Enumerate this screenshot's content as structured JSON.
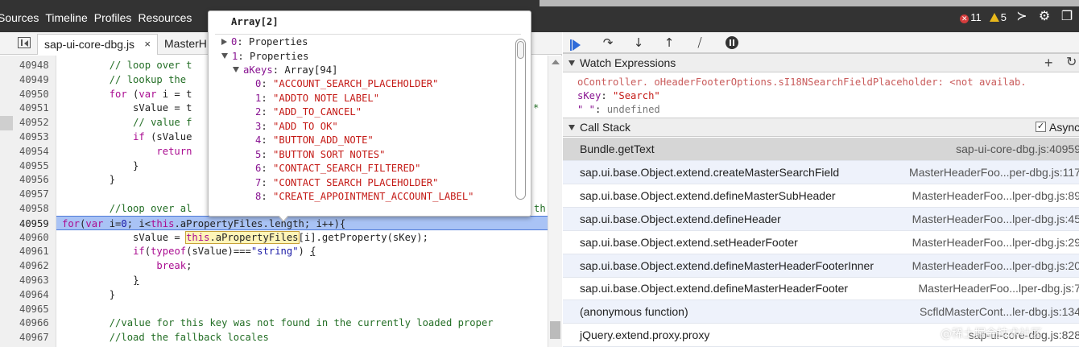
{
  "topbar": {
    "tabs": [
      "Sources",
      "Timeline",
      "Profiles",
      "Resources"
    ],
    "error_count": "11",
    "warning_count": "5"
  },
  "editor": {
    "active_file": "sap-ui-core-dbg.js",
    "second_file": "MasterH",
    "close_glyph": "×",
    "lines": [
      {
        "n": "40948",
        "html": "        <span class=\"cm\">// loop over t</span>"
      },
      {
        "n": "40949",
        "html": "        <span class=\"cm\">// lookup the</span>"
      },
      {
        "n": "40950",
        "html": "        <span class=\"kw\">for</span> (<span class=\"kw\">var</span> i = t"
      },
      {
        "n": "40951",
        "html": "            sValue = t"
      },
      {
        "n": "40952",
        "html": "            <span class=\"cm\">// value f</span>"
      },
      {
        "n": "40953",
        "html": "            <span class=\"kw\">if</span> (sValue"
      },
      {
        "n": "40954",
        "html": "                <span class=\"kw\">return</span>"
      },
      {
        "n": "40955",
        "html": "            }"
      },
      {
        "n": "40956",
        "html": "        }"
      },
      {
        "n": "40957",
        "html": ""
      },
      {
        "n": "40958",
        "html": "        <span class=\"cm\">//loop over al</span>"
      },
      {
        "n": "40959",
        "html": "<span class=\"kw\">for</span>(<span class=\"kw\">var</span> i=<span class=\"str\">0</span>; i&lt;<span class=\"kw\">this</span>.aPropertyFiles.length; i++){",
        "exec": true
      },
      {
        "n": "40960",
        "html": "            sValue = <span class=\"hl\"><span class=\"kw\">this</span>.aPropertyFiles</span>[i].getProperty(sKey);"
      },
      {
        "n": "40961",
        "html": "            <span class=\"kw\">if</span>(<span class=\"kw\">typeof</span>(sValue)===<span class=\"str\">\"string\"</span>) <span class=\"ul\">{</span>"
      },
      {
        "n": "40962",
        "html": "                <span class=\"kw\">break</span>;"
      },
      {
        "n": "40963",
        "html": "            <span class=\"ul\">}</span>"
      },
      {
        "n": "40964",
        "html": "        }"
      },
      {
        "n": "40965",
        "html": ""
      },
      {
        "n": "40966",
        "html": "        <span class=\"cm\">//value for this key was not found in the currently loaded proper</span>"
      },
      {
        "n": "40967",
        "html": "        <span class=\"cm\">//load the fallback locales</span>"
      }
    ],
    "right_overflow": {
      "l41": "*",
      "l47": "th"
    }
  },
  "popover": {
    "title": "Array[2]",
    "row0": {
      "key": "0",
      "value": "Properties"
    },
    "row1": {
      "key": "1",
      "value": "Properties"
    },
    "akeys": {
      "key": "aKeys",
      "value": "Array[94]"
    },
    "items": [
      {
        "i": "0",
        "v": "\"ACCOUNT_SEARCH_PLACEHOLDER\""
      },
      {
        "i": "1",
        "v": "\"ADDTO NOTE LABEL\""
      },
      {
        "i": "2",
        "v": "\"ADD_TO_CANCEL\""
      },
      {
        "i": "3",
        "v": "\"ADD TO OK\""
      },
      {
        "i": "4",
        "v": "\"BUTTON_ADD_NOTE\""
      },
      {
        "i": "5",
        "v": "\"BUTTON SORT NOTES\""
      },
      {
        "i": "6",
        "v": "\"CONTACT_SEARCH_FILTERED\""
      },
      {
        "i": "7",
        "v": "\"CONTACT SEARCH PLACEHOLDER\""
      },
      {
        "i": "8",
        "v": "\"CREATE_APPOINTMENT_ACCOUNT_LABEL\""
      }
    ]
  },
  "debugger": {
    "watch": {
      "title": "Watch Expressions",
      "expr1": "oController. oHeaderFooterOptions.sI18NSearchFieldPlaceholder: <not availab.",
      "expr2_key": "sKey",
      "expr2_val": "\"Search\"",
      "expr3_key": "\" \"",
      "expr3_val": "undefined"
    },
    "callstack": {
      "title": "Call Stack",
      "async_label": "Async",
      "frames": [
        {
          "fn": "Bundle.getText",
          "loc": "sap-ui-core-dbg.js:40959"
        },
        {
          "fn": "sap.ui.base.Object.extend.createMasterSearchField",
          "loc": "MasterHeaderFoo...per-dbg.js:117"
        },
        {
          "fn": "sap.ui.base.Object.extend.defineMasterSubHeader",
          "loc": "MasterHeaderFoo...lper-dbg.js:89"
        },
        {
          "fn": "sap.ui.base.Object.extend.defineHeader",
          "loc": "MasterHeaderFoo...lper-dbg.js:45"
        },
        {
          "fn": "sap.ui.base.Object.extend.setHeaderFooter",
          "loc": "MasterHeaderFoo...lper-dbg.js:29"
        },
        {
          "fn": "sap.ui.base.Object.extend.defineMasterHeaderFooterInner",
          "loc": "MasterHeaderFoo...lper-dbg.js:20"
        },
        {
          "fn": "sap.ui.base.Object.extend.defineMasterHeaderFooter",
          "loc": "MasterHeaderFoo...lper-dbg.js:7"
        },
        {
          "fn": "(anonymous function)",
          "loc": "ScfldMasterCont...ler-dbg.js:134"
        },
        {
          "fn": "jQuery.extend.proxy.proxy",
          "loc": "sap-ui-core-dbg.js:828"
        }
      ]
    }
  },
  "watermark": "@稀土掘金技术社区",
  "colors": {
    "toolbar_bg": "#333333",
    "exec_line": "#a9c3f5",
    "error": "#d43c3c",
    "warning": "#e8b81b",
    "play": "#2f6bd8"
  }
}
